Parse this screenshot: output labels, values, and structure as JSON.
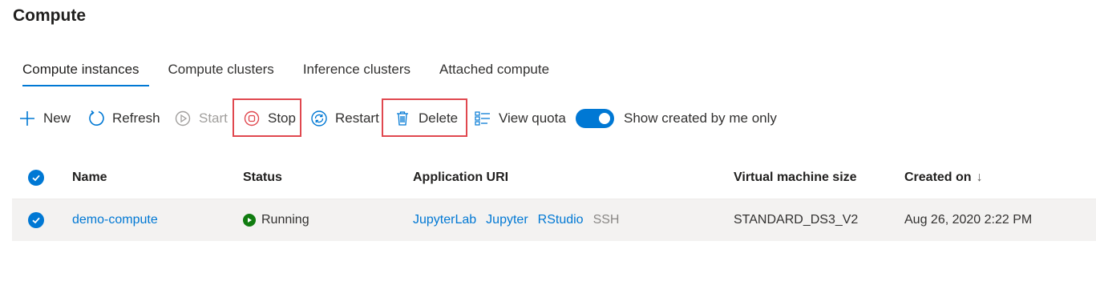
{
  "page": {
    "title": "Compute"
  },
  "tabs": [
    {
      "label": "Compute instances",
      "active": true
    },
    {
      "label": "Compute clusters",
      "active": false
    },
    {
      "label": "Inference clusters",
      "active": false
    },
    {
      "label": "Attached compute",
      "active": false
    }
  ],
  "toolbar": {
    "new_label": "New",
    "refresh_label": "Refresh",
    "start_label": "Start",
    "stop_label": "Stop",
    "restart_label": "Restart",
    "delete_label": "Delete",
    "view_quota_label": "View quota",
    "show_mine_label": "Show created by me only",
    "show_mine_on": true
  },
  "table": {
    "columns": {
      "name": "Name",
      "status": "Status",
      "app_uri": "Application URI",
      "vm_size": "Virtual machine size",
      "created_on": "Created on"
    },
    "sort_indicator": "↓",
    "rows": [
      {
        "name": "demo-compute",
        "status": "Running",
        "links": {
          "jupyterlab": "JupyterLab",
          "jupyter": "Jupyter",
          "rstudio": "RStudio",
          "ssh": "SSH"
        },
        "vm_size": "STANDARD_DS3_V2",
        "created_on": "Aug 26, 2020 2:22 PM"
      }
    ]
  },
  "colors": {
    "accent": "#0078d4",
    "highlight": "#e0484f",
    "running": "#107c10"
  }
}
